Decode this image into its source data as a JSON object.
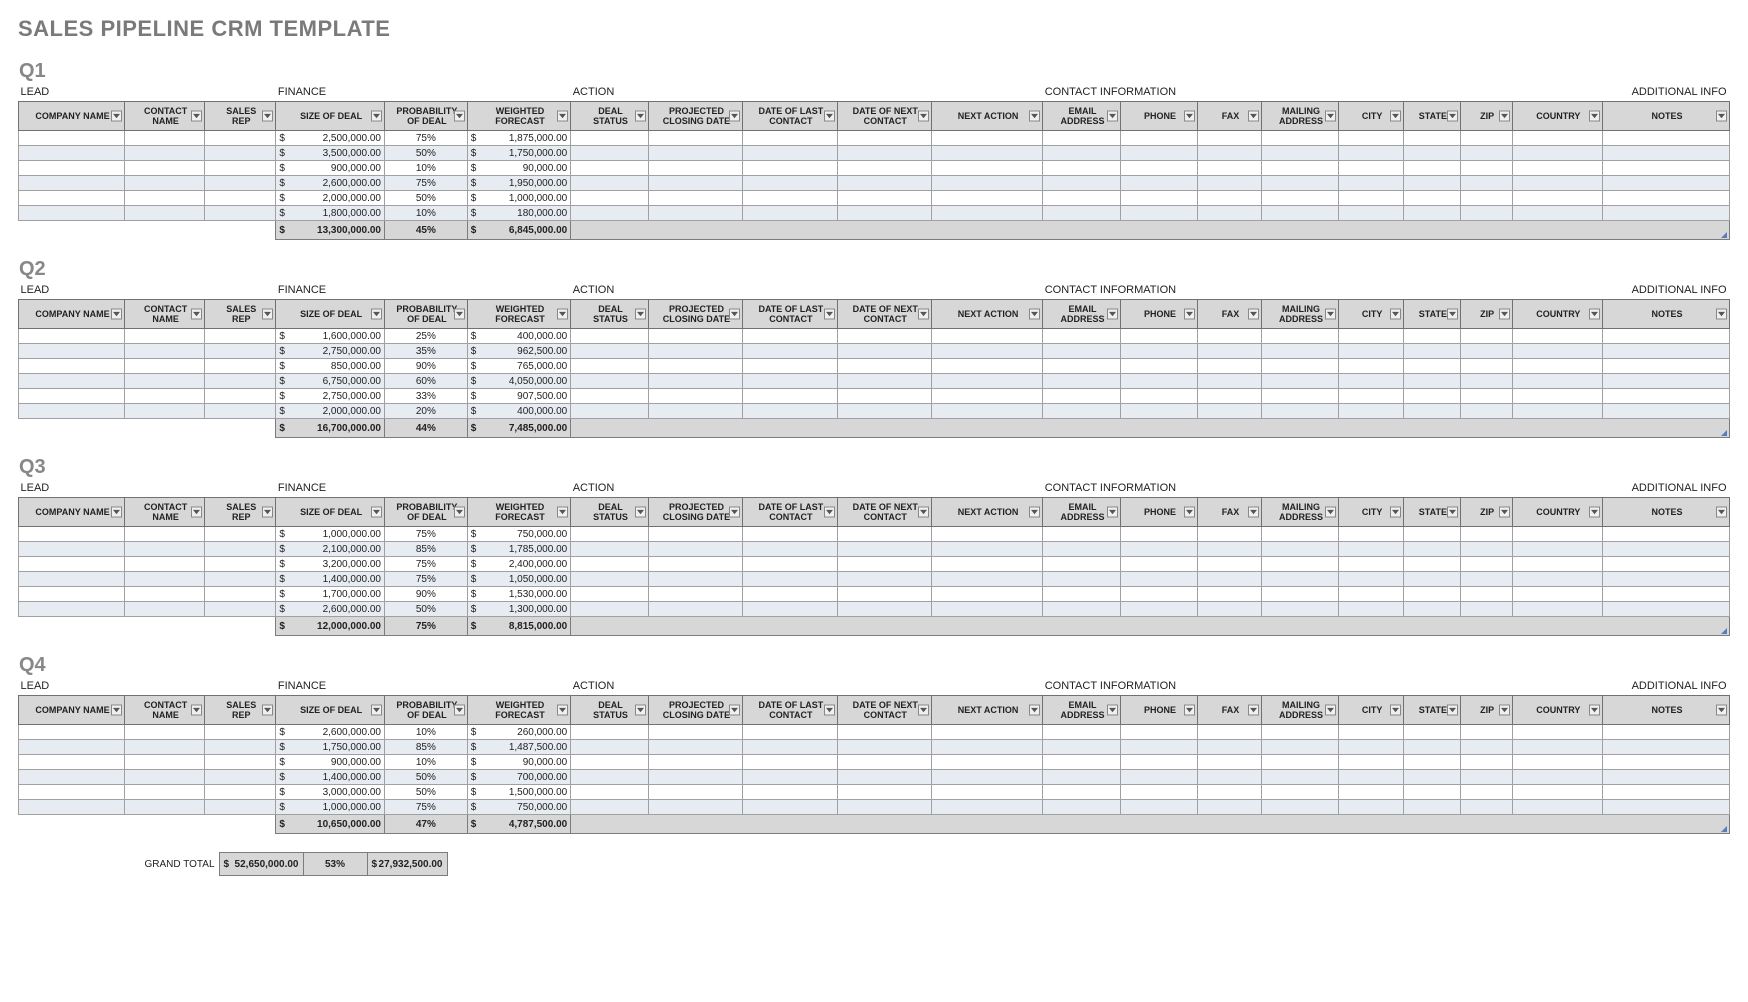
{
  "title": "SALES PIPELINE CRM TEMPLATE",
  "section_labels": {
    "lead": "LEAD",
    "finance": "FINANCE",
    "action": "ACTION",
    "contact": "CONTACT INFORMATION",
    "additional": "ADDITIONAL INFO"
  },
  "columns": [
    "COMPANY NAME",
    "CONTACT NAME",
    "SALES REP",
    "SIZE OF DEAL",
    "PROBABILITY OF DEAL",
    "WEIGHTED FORECAST",
    "DEAL STATUS",
    "PROJECTED CLOSING DATE",
    "DATE OF LAST CONTACT",
    "DATE OF NEXT CONTACT",
    "NEXT ACTION",
    "EMAIL ADDRESS",
    "PHONE",
    "FAX",
    "MAILING ADDRESS",
    "CITY",
    "STATE",
    "ZIP",
    "COUNTRY",
    "NOTES"
  ],
  "col_short": [
    "COMPANY NAME",
    "CONTACT NAME",
    "SALES REP",
    "SIZE OF DEAL",
    "PROBABILITY OF DEAL",
    "WEIGHTED FORECAST",
    "DEAL STATUS",
    "PROJECTED CLOSING DATE",
    "DATE OF LAST CONTACT",
    "DATE OF NEXT CONTACT",
    "NEXT ACTION",
    "EMAIL ADDRESS",
    "PHONE",
    "FAX",
    "MAILING ADDRESS",
    "CITY",
    "STATE",
    "ZIP",
    "COUNTRY",
    "NOTES"
  ],
  "quarters": [
    {
      "name": "Q1",
      "rows": [
        {
          "size": "2,500,000.00",
          "prob": "75%",
          "wf": "1,875,000.00"
        },
        {
          "size": "3,500,000.00",
          "prob": "50%",
          "wf": "1,750,000.00"
        },
        {
          "size": "900,000.00",
          "prob": "10%",
          "wf": "90,000.00"
        },
        {
          "size": "2,600,000.00",
          "prob": "75%",
          "wf": "1,950,000.00"
        },
        {
          "size": "2,000,000.00",
          "prob": "50%",
          "wf": "1,000,000.00"
        },
        {
          "size": "1,800,000.00",
          "prob": "10%",
          "wf": "180,000.00"
        }
      ],
      "total": {
        "size": "13,300,000.00",
        "prob": "45%",
        "wf": "6,845,000.00"
      }
    },
    {
      "name": "Q2",
      "rows": [
        {
          "size": "1,600,000.00",
          "prob": "25%",
          "wf": "400,000.00"
        },
        {
          "size": "2,750,000.00",
          "prob": "35%",
          "wf": "962,500.00"
        },
        {
          "size": "850,000.00",
          "prob": "90%",
          "wf": "765,000.00"
        },
        {
          "size": "6,750,000.00",
          "prob": "60%",
          "wf": "4,050,000.00"
        },
        {
          "size": "2,750,000.00",
          "prob": "33%",
          "wf": "907,500.00"
        },
        {
          "size": "2,000,000.00",
          "prob": "20%",
          "wf": "400,000.00"
        }
      ],
      "total": {
        "size": "16,700,000.00",
        "prob": "44%",
        "wf": "7,485,000.00"
      }
    },
    {
      "name": "Q3",
      "rows": [
        {
          "size": "1,000,000.00",
          "prob": "75%",
          "wf": "750,000.00"
        },
        {
          "size": "2,100,000.00",
          "prob": "85%",
          "wf": "1,785,000.00"
        },
        {
          "size": "3,200,000.00",
          "prob": "75%",
          "wf": "2,400,000.00"
        },
        {
          "size": "1,400,000.00",
          "prob": "75%",
          "wf": "1,050,000.00"
        },
        {
          "size": "1,700,000.00",
          "prob": "90%",
          "wf": "1,530,000.00"
        },
        {
          "size": "2,600,000.00",
          "prob": "50%",
          "wf": "1,300,000.00"
        }
      ],
      "total": {
        "size": "12,000,000.00",
        "prob": "75%",
        "wf": "8,815,000.00"
      }
    },
    {
      "name": "Q4",
      "rows": [
        {
          "size": "2,600,000.00",
          "prob": "10%",
          "wf": "260,000.00"
        },
        {
          "size": "1,750,000.00",
          "prob": "85%",
          "wf": "1,487,500.00"
        },
        {
          "size": "900,000.00",
          "prob": "10%",
          "wf": "90,000.00"
        },
        {
          "size": "1,400,000.00",
          "prob": "50%",
          "wf": "700,000.00"
        },
        {
          "size": "3,000,000.00",
          "prob": "50%",
          "wf": "1,500,000.00"
        },
        {
          "size": "1,000,000.00",
          "prob": "75%",
          "wf": "750,000.00"
        }
      ],
      "total": {
        "size": "10,650,000.00",
        "prob": "47%",
        "wf": "4,787,500.00"
      }
    }
  ],
  "grand": {
    "label": "GRAND TOTAL",
    "size": "52,650,000.00",
    "prob": "53%",
    "wf": "27,932,500.00"
  }
}
